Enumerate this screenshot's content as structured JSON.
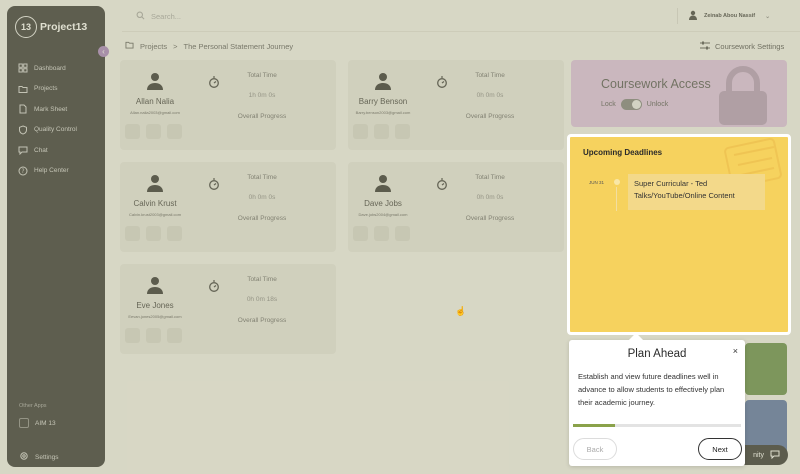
{
  "sidebar": {
    "logo_mark": "13",
    "brand": "Project13",
    "collapse_icon": "chevron-left-icon",
    "items": [
      {
        "label": "Dashboard",
        "icon": "dashboard-icon"
      },
      {
        "label": "Projects",
        "icon": "folder-icon"
      },
      {
        "label": "Mark Sheet",
        "icon": "document-icon"
      },
      {
        "label": "Quality Control",
        "icon": "shield-icon"
      },
      {
        "label": "Chat",
        "icon": "chat-icon"
      },
      {
        "label": "Help Center",
        "icon": "help-icon"
      }
    ],
    "other_apps_label": "Other Apps",
    "aim_label": "AIM 13",
    "settings_label": "Settings"
  },
  "topbar": {
    "search_placeholder": "Search...",
    "user_name": "Zeinab Abou Nassif",
    "user_chevron": "chevron-down-icon"
  },
  "breadcrumb": {
    "root": "Projects",
    "separator": ">",
    "current": "The Personal Statement Journey"
  },
  "coursework_settings_label": "Coursework Settings",
  "students": [
    {
      "name": "Allan Nalia",
      "email": "Allan.nalia2003@gmail.com",
      "total_time_label": "Total Time",
      "total_time": "1h 0m 0s",
      "overall_progress_label": "Overall Progress"
    },
    {
      "name": "Barry Benson",
      "email": "Barry.benson2003@gmail.com",
      "total_time_label": "Total Time",
      "total_time": "0h 0m 0s",
      "overall_progress_label": "Overall Progress"
    },
    {
      "name": "Calvin Krust",
      "email": "Calvin.krust2003@gmail.com",
      "total_time_label": "Total Time",
      "total_time": "0h 0m 0s",
      "overall_progress_label": "Overall Progress"
    },
    {
      "name": "Dave Jobs",
      "email": "Dave.jobs2004@gmail.com",
      "total_time_label": "Total Time",
      "total_time": "0h 0m 0s",
      "overall_progress_label": "Overall Progress"
    },
    {
      "name": "Eve Jones",
      "email": "Eevan.jones2005@gmail.com",
      "total_time_label": "Total Time",
      "total_time": "0h 0m 18s",
      "overall_progress_label": "Overall Progress"
    }
  ],
  "access": {
    "title": "Coursework Access",
    "lock_label": "Lock",
    "unlock_label": "Unlock"
  },
  "deadlines": {
    "title": "Upcoming Deadlines",
    "items": [
      {
        "date": "JUN 31",
        "text": "Super Curricular - Ted Talks/YouTube/Online Content"
      }
    ]
  },
  "community_label": "nity",
  "tour": {
    "title": "Plan Ahead",
    "close": "×",
    "body": "Establish and view future deadlines well in advance to allow students to effectively plan their academic journey.",
    "progress": 0.25,
    "back_label": "Back",
    "next_label": "Next"
  },
  "colors": {
    "sidebar": "#151515",
    "access_panel": "#d9b7de",
    "deadlines_panel": "#f6d25e",
    "progress_fill": "#8aa24a"
  }
}
